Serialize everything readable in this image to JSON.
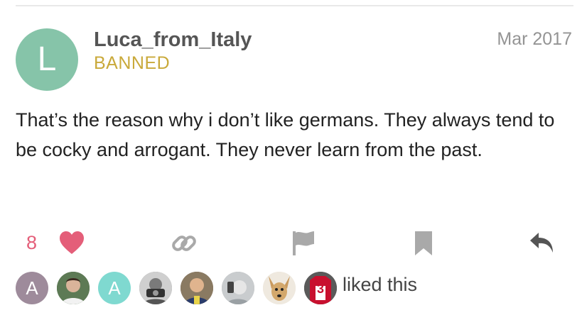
{
  "post": {
    "avatar_letter": "L",
    "username": "Luca_from_Italy",
    "user_title": "BANNED",
    "date": "Mar 2017",
    "body": "That’s the reason why i don’t like germans. They always tend to be cocky and arrogant. They never learn from the past."
  },
  "actions": {
    "like_count": "8",
    "icons": [
      "heart-icon",
      "link-icon",
      "flag-icon",
      "bookmark-icon",
      "reply-icon"
    ]
  },
  "likers": {
    "avatars": [
      {
        "letter": "A",
        "color": "#9e8b9b"
      },
      {
        "letter": "",
        "icon": "user-photo"
      },
      {
        "letter": "A",
        "color": "#7fd9d0"
      },
      {
        "letter": "",
        "icon": "user-photo"
      },
      {
        "letter": "",
        "icon": "user-photo"
      },
      {
        "letter": "",
        "icon": "user-photo"
      },
      {
        "letter": "",
        "icon": "dog-photo"
      },
      {
        "letter": "3",
        "icon": "jersey-photo"
      }
    ],
    "text": "liked this"
  },
  "colors": {
    "accent_like": "#e45e79",
    "banned_title": "#c9a93a",
    "avatar_main": "#86c4a9",
    "icon_gray": "#a9a9a9"
  }
}
